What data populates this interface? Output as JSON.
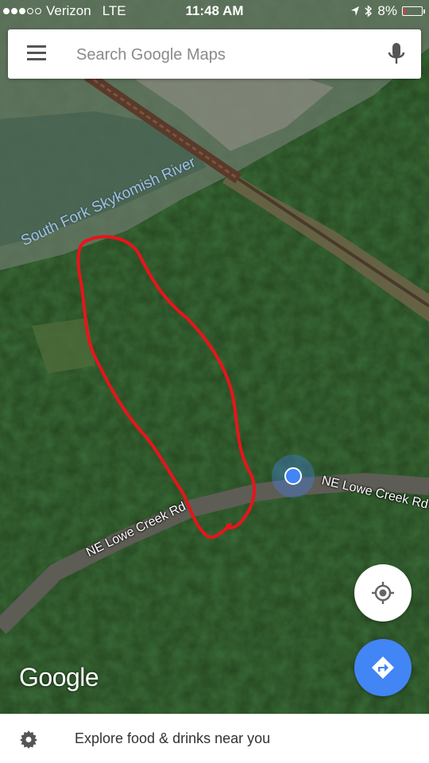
{
  "status_bar": {
    "carrier": "Verizon",
    "network": "LTE",
    "time": "11:48 AM",
    "battery": "8%",
    "signal_bars_filled": 3,
    "signal_bars_total": 5,
    "battery_level": 0.08,
    "icons": [
      "location-arrow-icon",
      "bluetooth-icon",
      "battery-icon"
    ]
  },
  "search": {
    "placeholder": "Search Google Maps",
    "value": ""
  },
  "map": {
    "labels": {
      "river": "South Fork Skykomish River",
      "road_1": "NE Lowe Creek Rd",
      "road_2": "NE Lowe Creek Rd"
    },
    "annotation_color": "#e8141b",
    "location_dot_color": "#4285f4",
    "logo": "Google"
  },
  "buttons": {
    "my_location_icon": "my-location-icon",
    "directions_icon": "directions-icon"
  },
  "bottom_bar": {
    "text": "Explore food & drinks near you",
    "icon": "gear-icon"
  }
}
